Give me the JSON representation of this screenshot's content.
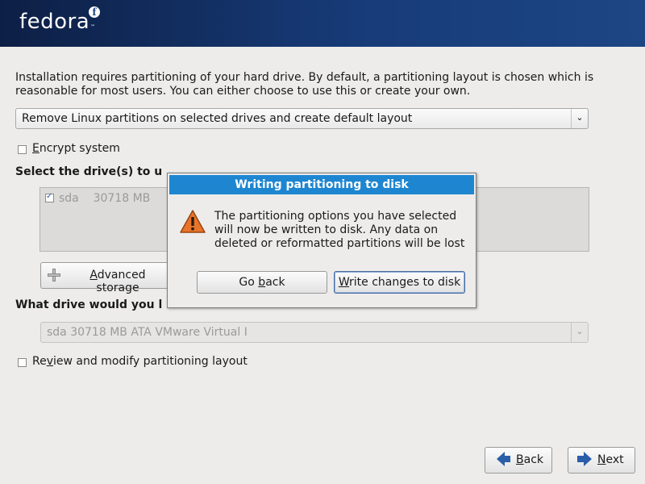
{
  "brand": {
    "name": "fedora",
    "mark": "f",
    "tm": "™"
  },
  "intro": "Installation requires partitioning of your hard drive.  By default, a partitioning layout is chosen which is reasonable for most users.  You can either choose to use this or create your own.",
  "layout_select": {
    "value": "Remove Linux partitions on selected drives and create default layout"
  },
  "encrypt": {
    "pre": "",
    "mnemonic": "E",
    "post": "ncrypt system",
    "checked": false
  },
  "drives_heading": "Select the drive(s) to u",
  "drives": [
    {
      "name": "sda",
      "size": "30718 MB",
      "checked": true
    }
  ],
  "advanced_button": {
    "pre": "",
    "mnemonic": "A",
    "post": "dvanced storage"
  },
  "boot_drive_heading": "What drive would you l",
  "boot_drive_select": {
    "value": "sda    30718 MB ATA VMware Virtual I"
  },
  "review": {
    "pre": "Re",
    "mnemonic": "v",
    "post": "iew and modify partitioning layout",
    "checked": false
  },
  "dialog": {
    "title": "Writing partitioning to disk",
    "message": "The partitioning options you have selected will now be written to disk.  Any data on deleted or reformatted partitions will be lost",
    "go_back": {
      "pre": "Go ",
      "mnemonic": "b",
      "post": "ack"
    },
    "write": {
      "pre": "",
      "mnemonic": "W",
      "post": "rite changes to disk"
    }
  },
  "nav": {
    "back": {
      "pre": "",
      "mnemonic": "B",
      "post": "ack"
    },
    "next": {
      "pre": "",
      "mnemonic": "N",
      "post": "ext"
    }
  },
  "colors": {
    "banner": "#173b78",
    "dialog_title": "#1e86d1",
    "nav_arrow": "#2a5ea8",
    "warning": "#e8742a"
  },
  "icons": {
    "warning": "warning-triangle-icon",
    "advanced": "plus-icon",
    "back": "left-arrow-icon",
    "next": "right-arrow-icon"
  }
}
